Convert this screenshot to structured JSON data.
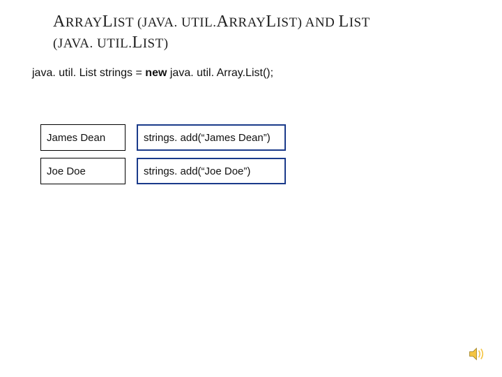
{
  "title": {
    "part1_big": "A",
    "part1_sm": "RRAY",
    "part2_big": "L",
    "part2_sm": "IST",
    "part3_sm": " (",
    "part4_sm": "JAVA",
    "part5_sm": ". ",
    "part6_sm": "UTIL",
    "part7_sm": ".",
    "part8_big": "A",
    "part8b_sm": "RRAY",
    "part9_big": "L",
    "part9b_sm": "IST",
    "part10_sm": ") ",
    "part11_sm": "AND",
    "part12_sm": " ",
    "part13_big": "L",
    "part13b_sm": "IST",
    "line2a_sm": "(",
    "line2b_sm": "JAVA",
    "line2c_sm": ". ",
    "line2d_sm": "UTIL",
    "line2e_sm": ".",
    "line2f_big": "L",
    "line2g_sm": "IST",
    "line2h_sm": ")"
  },
  "code_line_pre": "java. util. List strings = ",
  "code_line_new": "new",
  "code_line_post": " java. util. Array.List();",
  "rows": {
    "r1_name": "James Dean",
    "r1_code": "strings. add(“James Dean”)",
    "r2_name": "Joe Doe",
    "r2_code": "strings. add(“Joe Doe”)"
  }
}
